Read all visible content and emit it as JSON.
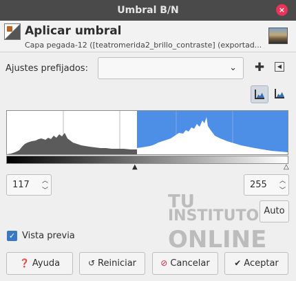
{
  "window": {
    "title": "Umbral B/N",
    "close_icon": "×"
  },
  "header": {
    "title": "Aplicar umbral",
    "subtitle": "Capa pegada-12 ([teatromerida2_brillo_contraste] (exportad..."
  },
  "presets": {
    "label": "Ajustes prefijados:",
    "value": "",
    "add_icon": "✚",
    "menu_icon": "◀"
  },
  "histogram": {
    "range_low_label": "117",
    "range_high_label": "255",
    "low_marker": "▲",
    "high_marker": "△"
  },
  "auto_button": {
    "label": "Auto"
  },
  "preview": {
    "label": "Vista previa",
    "checked": true,
    "check_icon": "✓"
  },
  "watermark": {
    "line1": "TU",
    "line2": "INSTITUTO",
    "line3": "ONLINE"
  },
  "buttons": {
    "help": {
      "icon": "❓",
      "label": "Ayuda"
    },
    "reset": {
      "icon": "↺",
      "label": "Reiniciar"
    },
    "cancel": {
      "icon": "⊘",
      "label": "Cancelar"
    },
    "ok": {
      "icon": "✔",
      "label": "Aceptar"
    }
  },
  "colors": {
    "highlight": "#4d8fe6",
    "histogram_dark": "#5b5b5b",
    "histogram_light": "#ffffff",
    "close": "#e8335a"
  }
}
